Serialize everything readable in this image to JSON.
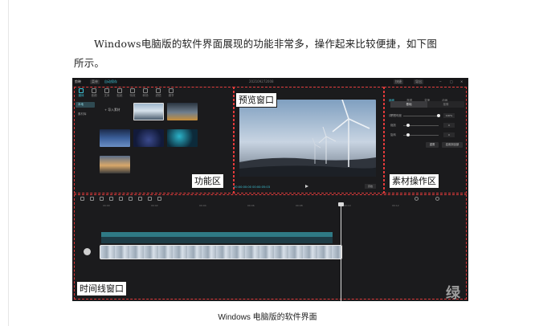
{
  "intro": {
    "line1": "Windows电脑版的软件界面展现的功能非常多，操作起来比较便捷，如下图",
    "line2": "所示。"
  },
  "screenshot": {
    "app_name": "剪映",
    "menu_label": "菜单",
    "autosave": "自动保存",
    "title": "202109272008",
    "shortcut": "快捷",
    "export_button": "导出",
    "function_tabs": [
      "媒体",
      "音频",
      "文本",
      "贴纸",
      "特效",
      "转场",
      "滤镜",
      "调节"
    ],
    "side_nav": [
      "本地",
      "素材库"
    ],
    "import_label": "+ 导入素材",
    "preview_timecode": "00:00:00:00  00:00:05:03",
    "preview_ratio": "原始",
    "material_tabs": [
      "画面",
      "音频",
      "变速",
      "动画",
      "调节"
    ],
    "material_subtabs": [
      "基础",
      "抠像"
    ],
    "material_rows": [
      {
        "label": "不透明度",
        "value": "100%"
      },
      {
        "label": "缩放",
        "value": "0"
      },
      {
        "label": "旋转",
        "value": "0"
      }
    ],
    "material_buttons": [
      "重置",
      "应用到全部"
    ],
    "ruler_labels": [
      "00:00",
      "00:02",
      "00:04",
      "00:06",
      "00:08",
      "00:10",
      "00:12"
    ]
  },
  "callouts": {
    "preview": "预览窗口",
    "function": "功能区",
    "material": "素材操作区",
    "timeline": "时间线窗口"
  },
  "watermark": "绿软",
  "caption": "Windows 电脑版的软件界面",
  "colors": {
    "accent": "#3ec6d9",
    "dashed_outline": "#e13a3a"
  }
}
